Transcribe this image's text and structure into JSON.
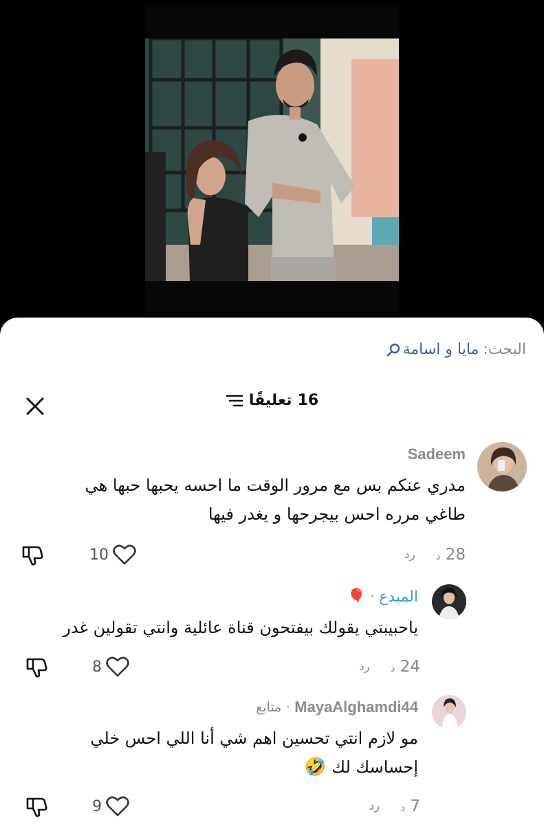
{
  "search": {
    "prefix": "البحث:",
    "query": "مايا و اسامة"
  },
  "header": {
    "count": "16",
    "title_word": "تعليقًا"
  },
  "comments": [
    {
      "author": "Sadeem",
      "text_line1": "مدري عنكم بس مع مرور الوقت ما احسه يحبها حبها هي",
      "text_line2": "طاغي مرره احس بيجرحها و يغدر فيها",
      "time": "28",
      "time_unit": "د",
      "reply": "رد",
      "likes": "10"
    },
    {
      "author": "المبدع",
      "author_emoji": "🎈",
      "text_line1": "ياحبيبتي يقولك بيفتحون قناة عائلية وانتي تقولين غدر",
      "time": "24",
      "time_unit": "د",
      "reply": "رد",
      "likes": "8"
    },
    {
      "author": "MayaAlghamdi44",
      "follow": "متابع",
      "text_line1": "مو لازم انتي تحسين اهم شي أنا اللي احس خلي",
      "text_line2": "إحساسك لك",
      "emoji": "🤣",
      "time": "7",
      "time_unit": "د",
      "reply": "رد",
      "likes": "9"
    }
  ]
}
